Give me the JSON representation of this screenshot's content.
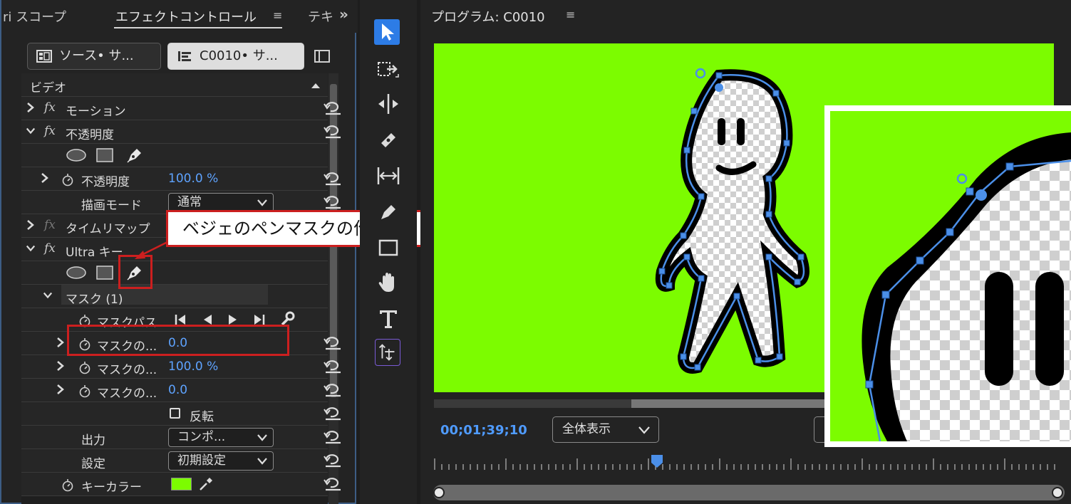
{
  "panel": {
    "tabs": [
      "ri スコープ",
      "エフェクトコントロール",
      "テキ"
    ],
    "menu_glyph": "≡",
    "overflow_glyph": "»",
    "source_left": "ソース• サ...",
    "source_right": "C0010• サ..."
  },
  "effects": {
    "video_header": "ビデオ",
    "motion": "モーション",
    "opacity": "不透明度",
    "opacity_param": "不透明度",
    "opacity_value": "100.0 %",
    "blend_mode_label": "描画モード",
    "blend_mode_value": "通常",
    "time_remap": "タイムリマップ",
    "ultra_key": "Ultra キー",
    "mask_group": "マスク (1)",
    "mask_path": "マスクパス",
    "mask_feather_label": "マスクの...",
    "mask_feather_value": "0.0",
    "mask_opacity_label": "マスクの...",
    "mask_opacity_value": "100.0 %",
    "mask_expansion_label": "マスクの...",
    "mask_expansion_value": "0.0",
    "invert_label": "反転",
    "output_label": "出力",
    "output_value": "コンポ...",
    "setting_label": "設定",
    "setting_value": "初期設定",
    "key_color_label": "キーカラー",
    "key_color": "#7cfc00"
  },
  "annotation": {
    "text": "ベジェのペンマスクの作成",
    "color": "#cc1f1f"
  },
  "monitor": {
    "title": "プログラム: C0010",
    "menu_glyph": "≡",
    "timecode": "00;01;39;10",
    "fit_value": "全体表示",
    "background_color": "#7cfc00"
  },
  "accent_color": "#3f8cff"
}
